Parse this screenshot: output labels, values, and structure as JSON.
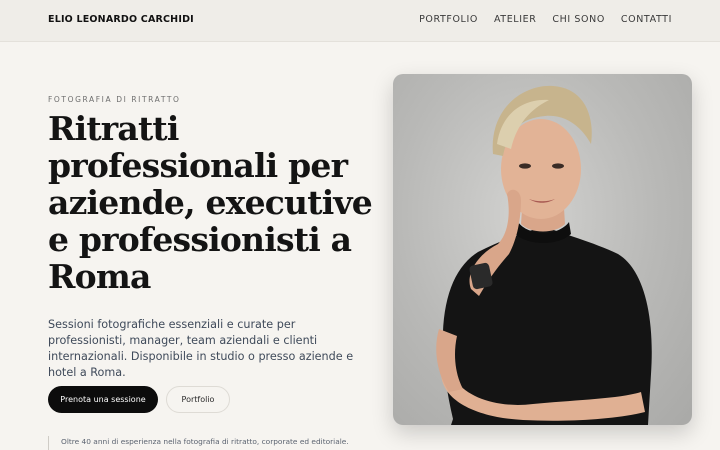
{
  "header": {
    "brand": "ELIO LEONARDO CARCHIDI",
    "nav": [
      "PORTFOLIO",
      "ATELIER",
      "CHI SONO",
      "CONTATTI"
    ]
  },
  "hero": {
    "eyebrow": "FOTOGRAFIA DI RITRATTO",
    "headline": "Ritratti professionali per aziende, executive e professionisti a Roma",
    "lead": "Sessioni fotografiche essenziali e curate per professionisti, manager, team aziendali e clienti internazionali. Disponibile in studio o presso aziende e hotel a Roma.",
    "primary_cta": "Prenota una sessione",
    "secondary_cta": "Portfolio",
    "note": "Oltre 40 anni di esperienza nella fotografia di ritratto, corporate ed editoriale."
  }
}
